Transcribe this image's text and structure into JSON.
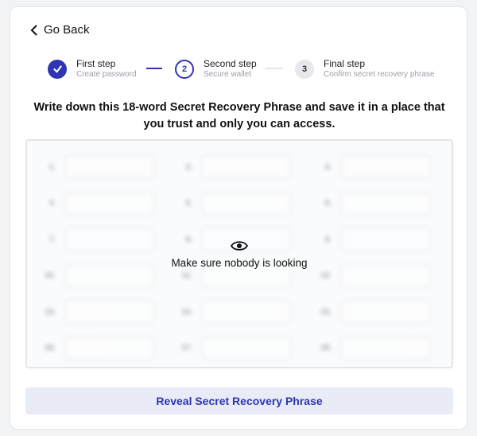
{
  "nav": {
    "back_label": "Go Back"
  },
  "steps": [
    {
      "title": "First step",
      "subtitle": "Create password",
      "state": "done",
      "number": ""
    },
    {
      "title": "Second step",
      "subtitle": "Secure wallet",
      "state": "current",
      "number": "2"
    },
    {
      "title": "Final step",
      "subtitle": "Confirm secret recovery phrase",
      "state": "pending",
      "number": "3"
    }
  ],
  "instruction": "Write down this 18-word Secret Recovery Phrase and save it in a place that you trust and only you can access.",
  "phrase": {
    "overlay_text": "Make sure nobody is looking",
    "numbers": [
      "1.",
      "2.",
      "3.",
      "4.",
      "5.",
      "6.",
      "7.",
      "8.",
      "9.",
      "10.",
      "11.",
      "12.",
      "13.",
      "14.",
      "15.",
      "16.",
      "17.",
      "18."
    ],
    "words": [
      "",
      "",
      "",
      "",
      "",
      "",
      "",
      "",
      "",
      "",
      "",
      "",
      "",
      "",
      "",
      "",
      "",
      ""
    ]
  },
  "reveal_button": "Reveal Secret Recovery Phrase",
  "colors": {
    "accent": "#2f35b2",
    "button_bg": "#e9ebf7"
  }
}
